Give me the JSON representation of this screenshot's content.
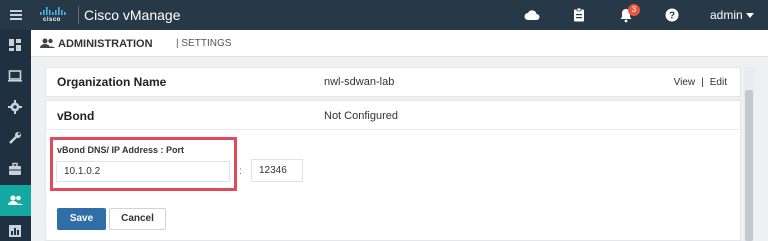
{
  "app": {
    "brand": "cisco",
    "title": "Cisco vManage",
    "notification_count": "3",
    "user": "admin"
  },
  "topbar_icons": [
    "cloud-icon",
    "clipboard-icon",
    "bell-icon",
    "help-icon"
  ],
  "nav_icons": [
    "menu-icon",
    "dashboard-icon",
    "monitor-icon",
    "configuration-icon",
    "tools-icon",
    "maintenance-icon",
    "administration-icon",
    "analytics-icon"
  ],
  "breadcrumb": {
    "section": "ADMINISTRATION",
    "separator": "|",
    "page": "SETTINGS"
  },
  "organization": {
    "label": "Organization Name",
    "value": "nwl-sdwan-lab",
    "view": "View",
    "pipe": "|",
    "edit": "Edit"
  },
  "vbond": {
    "label": "vBond",
    "value": "Not Configured",
    "field_label": "vBond DNS/ IP Address : Port",
    "ip_value": "10.1.0.2",
    "colon": ":",
    "port_value": "12346",
    "save": "Save",
    "cancel": "Cancel"
  },
  "colors": {
    "topbar": "#273947",
    "active_nav": "#13a8a0",
    "save_button": "#2f6ea6",
    "highlight_box": "#e34a59",
    "badge": "#e8543f"
  }
}
